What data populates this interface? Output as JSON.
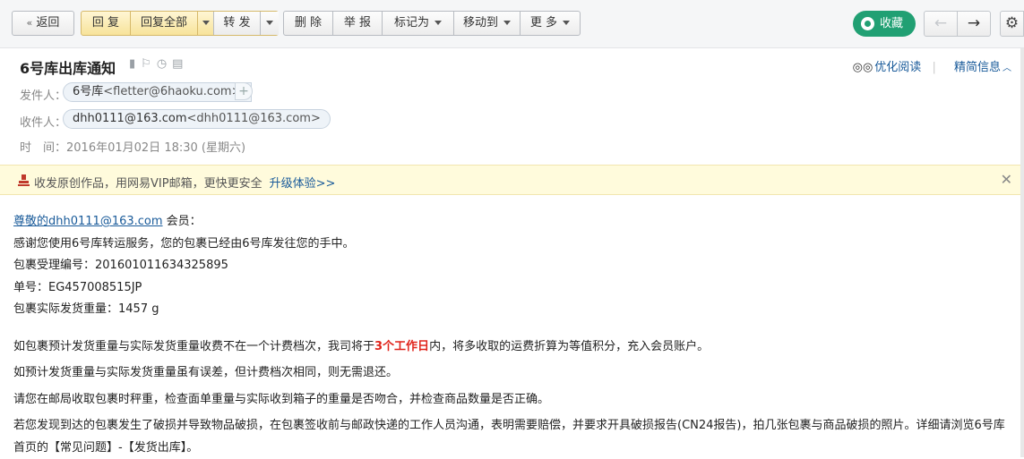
{
  "toolbar": {
    "back": "返回",
    "reply": "回 复",
    "reply_all": "回复全部",
    "forward": "转 发",
    "delete": "删 除",
    "report": "举 报",
    "mark_as": "标记为",
    "move_to": "移动到",
    "more": "更 多",
    "favorite": "收藏",
    "prev_glyph": "←",
    "next_glyph": "→",
    "settings_glyph": "⚙"
  },
  "mail": {
    "subject": "6号库出库通知",
    "sender_label": "发件人：",
    "sender_name": "6号库",
    "sender_email": "<fletter@6haoku.com>",
    "recipient_label": "收件人：",
    "recipient_name": "dhh0111@163.com",
    "recipient_email": "<dhh0111@163.com>",
    "time_label": "时　间：",
    "time_value": "2016年01月02日 18:30 (星期六)",
    "optimize_read": "优化阅读",
    "compact_info": "精简信息"
  },
  "notice": {
    "text": "收发原创作品，用网易VIP邮箱，更快更安全",
    "link": "升级体验>>"
  },
  "body": {
    "greeting_link": "尊敬的dhh0111@163.com",
    "greeting_suffix": " 会员：",
    "line1": "感谢您使用6号库转运服务，您的包裹已经由6号库发往您的手中。",
    "line2": "包裹受理编号：20160101163432589​5",
    "line3": "单号：EG457008515JP",
    "line4": "包裹实际发货重量：1457 g",
    "para1_a": "如包裹预计发货重量与实际发货重量收费不在一个计费档次，我司将于",
    "para1_red": "3个工作日",
    "para1_b": "内，将多收取的运费折算为等值积分，充入会员账户。",
    "para2": "如预计发货重量与实际发货重量虽有误差，但计费档次相同，则无需退还。",
    "para3": "请您在邮局收取包裹时秤重，检查面单重量与实际收到箱子的重量是否吻合，并检查商品数量是否正确。",
    "para4": "若您发现到达的包裹发生了破损并导致物品破损，在包裹签收前与邮政快递的工作人员沟通，表明需要赔偿，并要求开具破损报告(CN24报告)，拍几张包裹与商品破损的照片。详细请浏览6号库首页的【常见问题】-【发货出库】。"
  }
}
